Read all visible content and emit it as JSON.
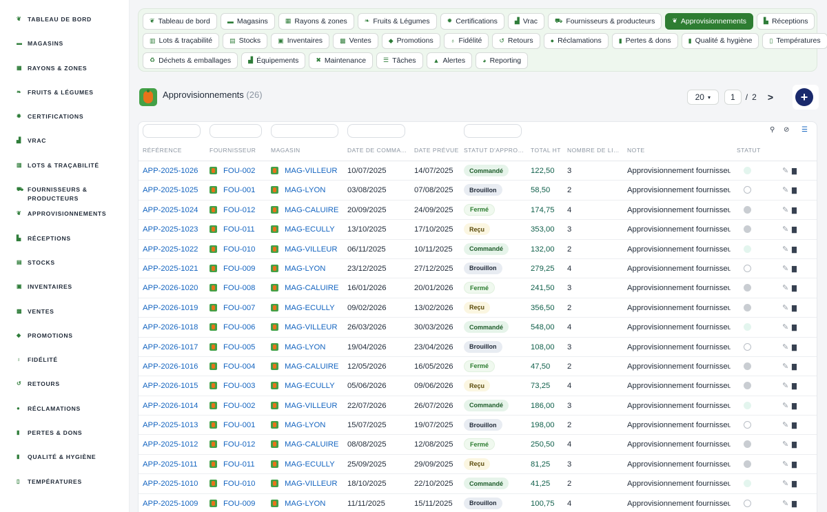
{
  "sidebar": {
    "items": [
      {
        "label": "Tableau de bord",
        "icon": "leaf-icon",
        "glyph": "❦"
      },
      {
        "label": "Magasins",
        "icon": "store-icon",
        "glyph": "▬"
      },
      {
        "label": "Rayons & zones",
        "icon": "grid-icon",
        "glyph": "▦"
      },
      {
        "label": "Fruits & Légumes",
        "icon": "leaf-icon",
        "glyph": "❧"
      },
      {
        "label": "Certifications",
        "icon": "certificate-icon",
        "glyph": "✹"
      },
      {
        "label": "Vrac",
        "icon": "bulk-icon",
        "glyph": "▟"
      },
      {
        "label": "Lots & traçabilité",
        "icon": "barcode-icon",
        "glyph": "▥"
      },
      {
        "label": "Fournisseurs & producteurs",
        "icon": "tractor-icon",
        "glyph": "⛟"
      },
      {
        "label": "Approvisionnements",
        "icon": "seedling-icon",
        "glyph": "❦"
      },
      {
        "label": "Réceptions",
        "icon": "truck-icon",
        "glyph": "▙"
      },
      {
        "label": "Stocks",
        "icon": "warehouse-icon",
        "glyph": "▤"
      },
      {
        "label": "Inventaires",
        "icon": "clipboard-icon",
        "glyph": "▣"
      },
      {
        "label": "Ventes",
        "icon": "cash-register-icon",
        "glyph": "▩"
      },
      {
        "label": "Promotions",
        "icon": "tag-icon",
        "glyph": "◆"
      },
      {
        "label": "Fidélité",
        "icon": "award-icon",
        "glyph": "♁"
      },
      {
        "label": "Retours",
        "icon": "undo-icon",
        "glyph": "↺"
      },
      {
        "label": "Réclamations",
        "icon": "comment-icon",
        "glyph": "●"
      },
      {
        "label": "Pertes & dons",
        "icon": "receipt-icon",
        "glyph": "▮"
      },
      {
        "label": "Qualité & hygiène",
        "icon": "quality-icon",
        "glyph": "▮"
      },
      {
        "label": "Températures",
        "icon": "thermometer-icon",
        "glyph": "▯"
      }
    ]
  },
  "chips": [
    [
      {
        "label": "Tableau de bord",
        "icon": "leaf-icon",
        "glyph": "❦"
      },
      {
        "label": "Magasins",
        "icon": "store-icon",
        "glyph": "▬"
      },
      {
        "label": "Rayons & zones",
        "icon": "grid-icon",
        "glyph": "▦"
      },
      {
        "label": "Fruits & Légumes",
        "icon": "leaf-icon",
        "glyph": "❧"
      },
      {
        "label": "Certifications",
        "icon": "certificate-icon",
        "glyph": "✹"
      },
      {
        "label": "Vrac",
        "icon": "bulk-icon",
        "glyph": "▟"
      },
      {
        "label": "Fournisseurs & producteurs",
        "icon": "tractor-icon",
        "glyph": "⛟"
      },
      {
        "label": "Approvisionnements",
        "icon": "seedling-icon",
        "glyph": "❦",
        "active": true
      },
      {
        "label": "Réceptions",
        "icon": "truck-icon",
        "glyph": "▙"
      }
    ],
    [
      {
        "label": "Lots & traçabilité",
        "icon": "barcode-icon",
        "glyph": "▥"
      },
      {
        "label": "Stocks",
        "icon": "warehouse-icon",
        "glyph": "▤"
      },
      {
        "label": "Inventaires",
        "icon": "clipboard-icon",
        "glyph": "▣"
      },
      {
        "label": "Ventes",
        "icon": "cash-register-icon",
        "glyph": "▩"
      },
      {
        "label": "Promotions",
        "icon": "tag-icon",
        "glyph": "◆"
      },
      {
        "label": "Fidélité",
        "icon": "award-icon",
        "glyph": "♁"
      },
      {
        "label": "Retours",
        "icon": "undo-icon",
        "glyph": "↺"
      },
      {
        "label": "Réclamations",
        "icon": "comment-icon",
        "glyph": "●"
      },
      {
        "label": "Pertes & dons",
        "icon": "receipt-icon",
        "glyph": "▮"
      },
      {
        "label": "Qualité & hygiène",
        "icon": "quality-icon",
        "glyph": "▮"
      },
      {
        "label": "Températures",
        "icon": "thermometer-icon",
        "glyph": "▯"
      }
    ],
    [
      {
        "label": "Déchets & emballages",
        "icon": "recycle-icon",
        "glyph": "♻"
      },
      {
        "label": "Équipements",
        "icon": "equipment-icon",
        "glyph": "▟"
      },
      {
        "label": "Maintenance",
        "icon": "tools-icon",
        "glyph": "✖"
      },
      {
        "label": "Tâches",
        "icon": "tasks-icon",
        "glyph": "☰"
      },
      {
        "label": "Alertes",
        "icon": "bell-icon",
        "glyph": "▲"
      },
      {
        "label": "Reporting",
        "icon": "chart-pie-icon",
        "glyph": "◕"
      }
    ]
  ],
  "page": {
    "title": "Approvisionnements",
    "count": "(26)",
    "page_size": "20",
    "current_page": "1",
    "separator": "/",
    "total_pages": "2",
    "next_label": ">",
    "add_label": "+"
  },
  "table": {
    "columns": [
      "Référence",
      "Fournisseur",
      "Magasin",
      "Date de comma…",
      "Date prévue",
      "Statut d'appro…",
      "Total HT",
      "Nombre de li…",
      "Note",
      "Statut"
    ],
    "rows": [
      {
        "ref": "APP-2025-1026",
        "fournisseur": "FOU-002",
        "magasin": "MAG-VILLEUR",
        "date_cmd": "10/07/2025",
        "date_prevue": "14/07/2025",
        "statut": "Commandé",
        "total": "122,50",
        "nb": "3",
        "note": "Approvisionnement fournisseur.",
        "etat": "light"
      },
      {
        "ref": "APP-2025-1025",
        "fournisseur": "FOU-001",
        "magasin": "MAG-LYON",
        "date_cmd": "03/08/2025",
        "date_prevue": "07/08/2025",
        "statut": "Brouillon",
        "total": "58,50",
        "nb": "2",
        "note": "Approvisionnement fournisseur.",
        "etat": "empty"
      },
      {
        "ref": "APP-2025-1024",
        "fournisseur": "FOU-012",
        "magasin": "MAG-CALUIRE",
        "date_cmd": "20/09/2025",
        "date_prevue": "24/09/2025",
        "statut": "Fermé",
        "total": "174,75",
        "nb": "4",
        "note": "Approvisionnement fournisseur.",
        "etat": "gray"
      },
      {
        "ref": "APP-2025-1023",
        "fournisseur": "FOU-011",
        "magasin": "MAG-ECULLY",
        "date_cmd": "13/10/2025",
        "date_prevue": "17/10/2025",
        "statut": "Reçu",
        "total": "353,00",
        "nb": "3",
        "note": "Approvisionnement fournisseur.",
        "etat": "gray"
      },
      {
        "ref": "APP-2025-1022",
        "fournisseur": "FOU-010",
        "magasin": "MAG-VILLEUR",
        "date_cmd": "06/11/2025",
        "date_prevue": "10/11/2025",
        "statut": "Commandé",
        "total": "132,00",
        "nb": "2",
        "note": "Approvisionnement fournisseur.",
        "etat": "light"
      },
      {
        "ref": "APP-2025-1021",
        "fournisseur": "FOU-009",
        "magasin": "MAG-LYON",
        "date_cmd": "23/12/2025",
        "date_prevue": "27/12/2025",
        "statut": "Brouillon",
        "total": "279,25",
        "nb": "4",
        "note": "Approvisionnement fournisseur.",
        "etat": "empty"
      },
      {
        "ref": "APP-2026-1020",
        "fournisseur": "FOU-008",
        "magasin": "MAG-CALUIRE",
        "date_cmd": "16/01/2026",
        "date_prevue": "20/01/2026",
        "statut": "Fermé",
        "total": "241,50",
        "nb": "3",
        "note": "Approvisionnement fournisseur.",
        "etat": "gray"
      },
      {
        "ref": "APP-2026-1019",
        "fournisseur": "FOU-007",
        "magasin": "MAG-ECULLY",
        "date_cmd": "09/02/2026",
        "date_prevue": "13/02/2026",
        "statut": "Reçu",
        "total": "356,50",
        "nb": "2",
        "note": "Approvisionnement fournisseur.",
        "etat": "gray"
      },
      {
        "ref": "APP-2026-1018",
        "fournisseur": "FOU-006",
        "magasin": "MAG-VILLEUR",
        "date_cmd": "26/03/2026",
        "date_prevue": "30/03/2026",
        "statut": "Commandé",
        "total": "548,00",
        "nb": "4",
        "note": "Approvisionnement fournisseur.",
        "etat": "light"
      },
      {
        "ref": "APP-2026-1017",
        "fournisseur": "FOU-005",
        "magasin": "MAG-LYON",
        "date_cmd": "19/04/2026",
        "date_prevue": "23/04/2026",
        "statut": "Brouillon",
        "total": "108,00",
        "nb": "3",
        "note": "Approvisionnement fournisseur.",
        "etat": "empty"
      },
      {
        "ref": "APP-2026-1016",
        "fournisseur": "FOU-004",
        "magasin": "MAG-CALUIRE",
        "date_cmd": "12/05/2026",
        "date_prevue": "16/05/2026",
        "statut": "Fermé",
        "total": "47,50",
        "nb": "2",
        "note": "Approvisionnement fournisseur.",
        "etat": "gray"
      },
      {
        "ref": "APP-2026-1015",
        "fournisseur": "FOU-003",
        "magasin": "MAG-ECULLY",
        "date_cmd": "05/06/2026",
        "date_prevue": "09/06/2026",
        "statut": "Reçu",
        "total": "73,25",
        "nb": "4",
        "note": "Approvisionnement fournisseur.",
        "etat": "gray"
      },
      {
        "ref": "APP-2026-1014",
        "fournisseur": "FOU-002",
        "magasin": "MAG-VILLEUR",
        "date_cmd": "22/07/2026",
        "date_prevue": "26/07/2026",
        "statut": "Commandé",
        "total": "186,00",
        "nb": "3",
        "note": "Approvisionnement fournisseur.",
        "etat": "light"
      },
      {
        "ref": "APP-2025-1013",
        "fournisseur": "FOU-001",
        "magasin": "MAG-LYON",
        "date_cmd": "15/07/2025",
        "date_prevue": "19/07/2025",
        "statut": "Brouillon",
        "total": "198,00",
        "nb": "2",
        "note": "Approvisionnement fournisseur.",
        "etat": "empty"
      },
      {
        "ref": "APP-2025-1012",
        "fournisseur": "FOU-012",
        "magasin": "MAG-CALUIRE",
        "date_cmd": "08/08/2025",
        "date_prevue": "12/08/2025",
        "statut": "Fermé",
        "total": "250,50",
        "nb": "4",
        "note": "Approvisionnement fournisseur.",
        "etat": "gray"
      },
      {
        "ref": "APP-2025-1011",
        "fournisseur": "FOU-011",
        "magasin": "MAG-ECULLY",
        "date_cmd": "25/09/2025",
        "date_prevue": "29/09/2025",
        "statut": "Reçu",
        "total": "81,25",
        "nb": "3",
        "note": "Approvisionnement fournisseur.",
        "etat": "gray"
      },
      {
        "ref": "APP-2025-1010",
        "fournisseur": "FOU-010",
        "magasin": "MAG-VILLEUR",
        "date_cmd": "18/10/2025",
        "date_prevue": "22/10/2025",
        "statut": "Commandé",
        "total": "41,25",
        "nb": "2",
        "note": "Approvisionnement fournisseur.",
        "etat": "light"
      },
      {
        "ref": "APP-2025-1009",
        "fournisseur": "FOU-009",
        "magasin": "MAG-LYON",
        "date_cmd": "11/11/2025",
        "date_prevue": "15/11/2025",
        "statut": "Brouillon",
        "total": "100,75",
        "nb": "4",
        "note": "Approvisionnement fournisseur.",
        "etat": "empty"
      }
    ]
  }
}
